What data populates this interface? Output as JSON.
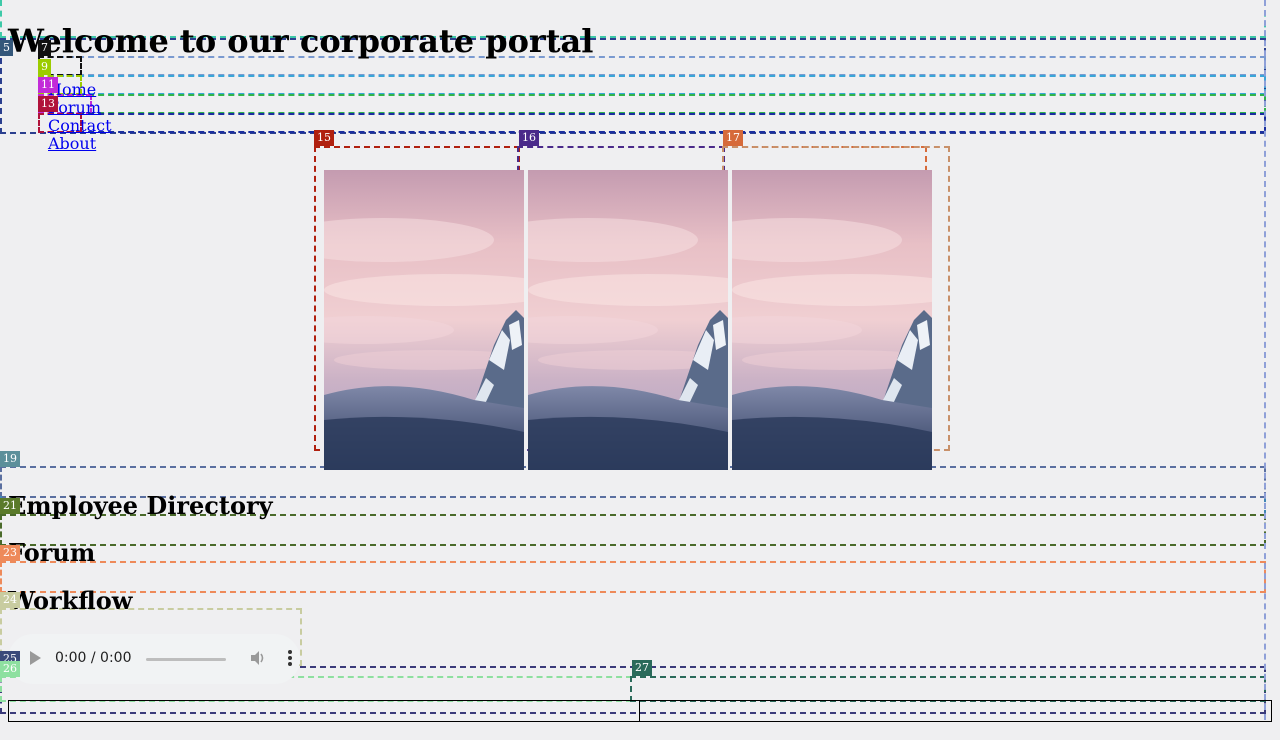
{
  "header": {
    "title": "Welcome to our corporate portal"
  },
  "nav": {
    "items": [
      {
        "label": "Home"
      },
      {
        "label": "Forum"
      },
      {
        "label": "Contact"
      },
      {
        "label": "About"
      }
    ]
  },
  "gallery": {
    "images": [
      {
        "alt": "Mountain peak at sunset"
      },
      {
        "alt": "Mountain peak at sunset"
      },
      {
        "alt": "Mountain peak at sunset"
      }
    ]
  },
  "sections": {
    "employee_directory": "Employee Directory",
    "forum": "Forum",
    "workflow": "Workflow"
  },
  "audio": {
    "time": "0:00 / 0:00"
  },
  "annotations": {
    "tags": [
      "5",
      "7",
      "9",
      "11",
      "13",
      "15",
      "16",
      "17",
      "19",
      "21",
      "23",
      "24",
      "25",
      "26",
      "27"
    ]
  },
  "colors": {
    "page_background": "#efeff1",
    "link": "#0000ee",
    "tag_5": "#34577a",
    "tag_7": "#111111",
    "tag_9": "#9ccc00",
    "tag_11": "#c22bd8",
    "tag_13": "#b0123a",
    "tag_15": "#b0200f",
    "tag_16": "#4a2a8a",
    "tag_17": "#d66a3a",
    "tag_19": "#5c8f9a",
    "tag_21": "#5a7a2a",
    "tag_23": "#ee8a5a",
    "tag_24": "#c8cca0",
    "tag_25": "#3a4a7a",
    "tag_26": "#8ee0a0",
    "tag_27": "#2a6a5a"
  }
}
